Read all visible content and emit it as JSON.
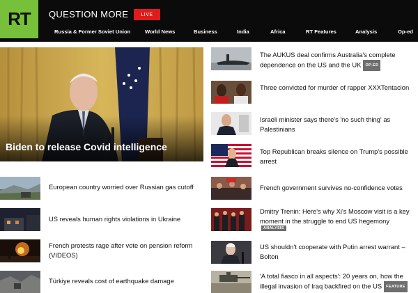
{
  "header": {
    "logo": "RT",
    "tagline": "QUESTION MORE",
    "live_label": "LIVE",
    "nav": [
      "Russia & Former Soviet Union",
      "World News",
      "Business",
      "India",
      "Africa",
      "RT Features",
      "Analysis",
      "Op-ed"
    ]
  },
  "hero": {
    "headline": "Biden to release Covid intelligence"
  },
  "left_list": [
    {
      "headline": "European country worried over Russian gas cutoff"
    },
    {
      "headline": "US reveals human rights violations in Ukraine"
    },
    {
      "headline": "French protests rage after vote on pension reform (VIDEOS)"
    },
    {
      "headline": "Türkiye reveals cost of earthquake damage"
    }
  ],
  "right_list": [
    {
      "headline": "The AUKUS deal confirms Australia's complete dependence on the US and the UK",
      "tag": "OP-ED"
    },
    {
      "headline": "Three convicted for murder of rapper XXXTentacion"
    },
    {
      "headline": "Israeli minister says there's 'no such thing' as Palestinians"
    },
    {
      "headline": "Top Republican breaks silence on Trump's possible arrest"
    },
    {
      "headline": "French government survives no-confidence votes"
    },
    {
      "headline": "Dmitry Trenin: Here's why Xi's Moscow visit is a key moment in the struggle to end US hegemony",
      "tag": "ANALYSIS"
    },
    {
      "headline": "US shouldn't cooperate with Putin arrest warrant – Bolton"
    },
    {
      "headline": "'A total fiasco in all aspects': 20 years on, how the illegal invasion of Iraq backfired on the US",
      "tag": "FEATURE"
    }
  ],
  "colors": {
    "brand_green": "#77c13a",
    "live_red": "#e01b1b",
    "topbar": "#0b0b0b",
    "tag_grey": "#6e6e6e"
  }
}
